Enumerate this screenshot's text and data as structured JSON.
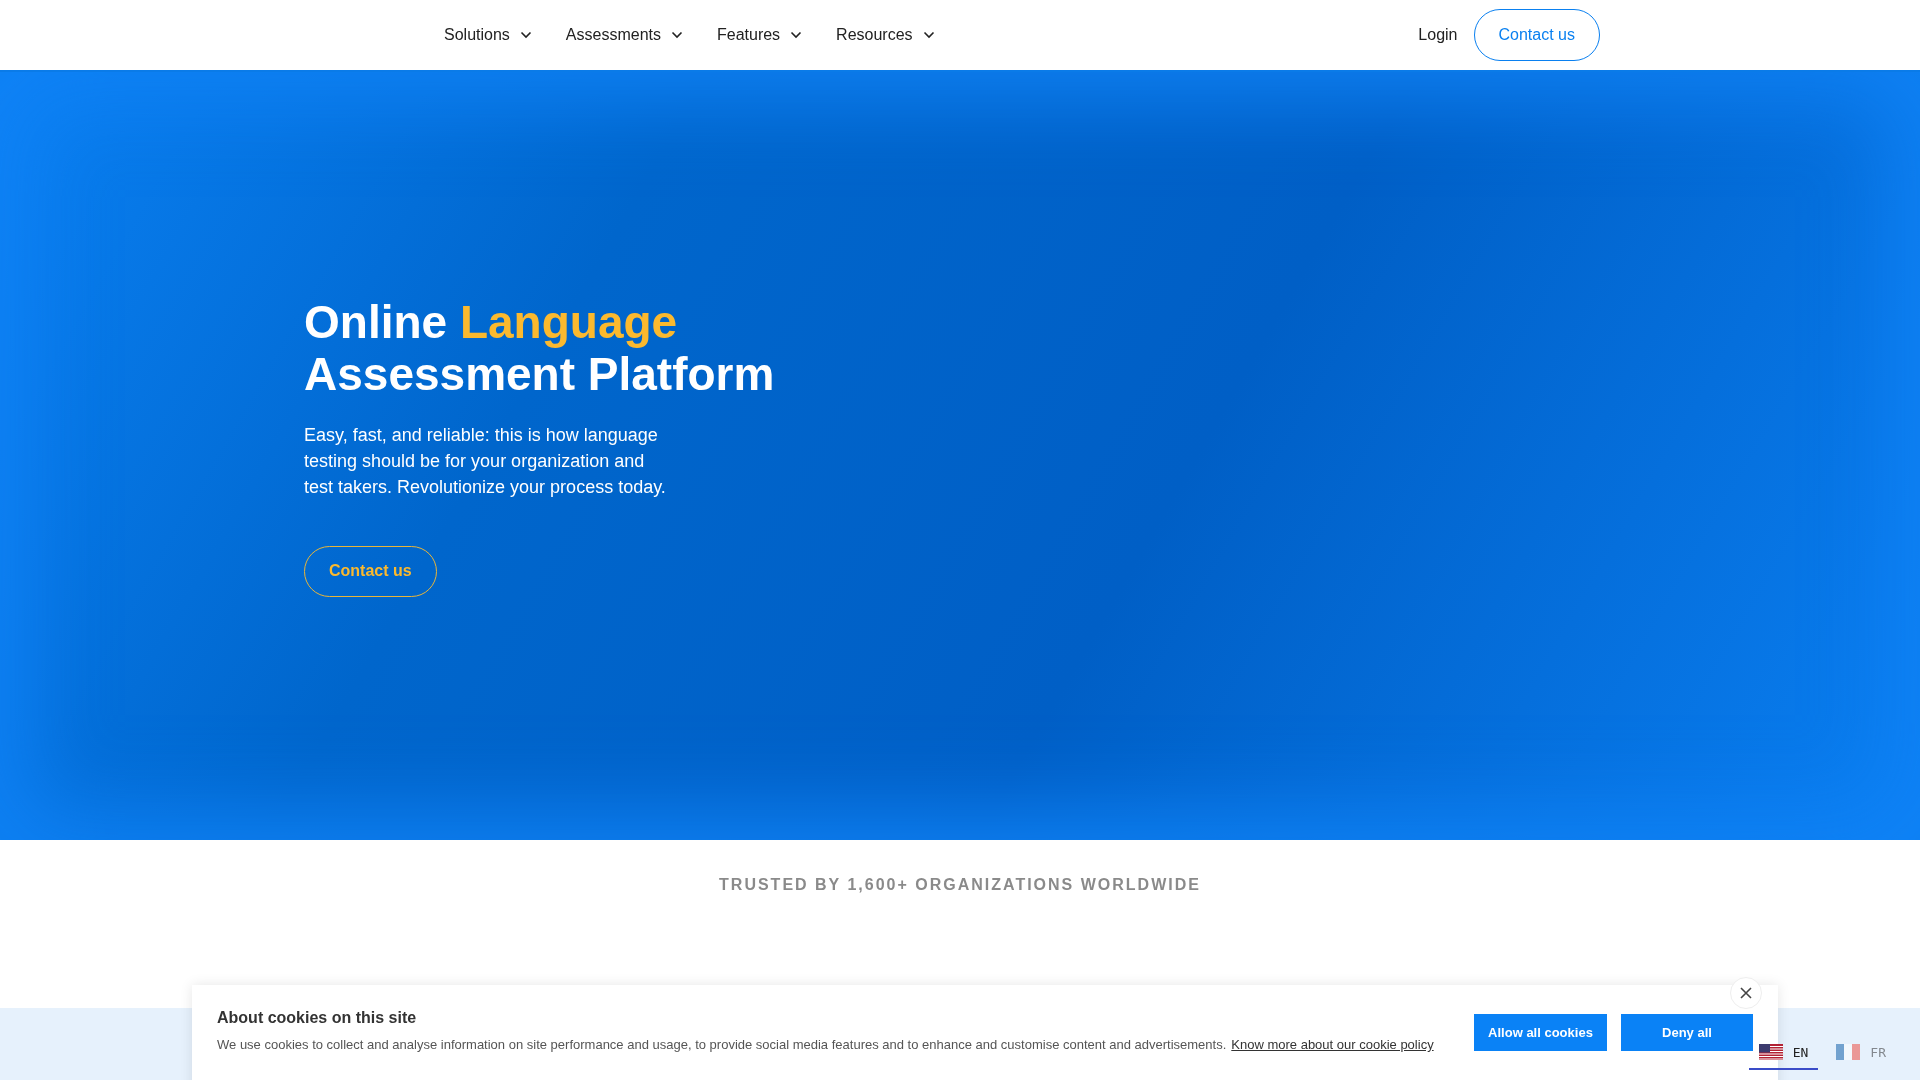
{
  "nav": {
    "items": [
      {
        "label": "Solutions"
      },
      {
        "label": "Assessments"
      },
      {
        "label": "Features"
      },
      {
        "label": "Resources"
      }
    ],
    "login": "Login",
    "contact": "Contact us"
  },
  "hero": {
    "title_lines": [
      {
        "parts": [
          {
            "text": "Online",
            "highlight": false
          },
          {
            "text": "Language",
            "highlight": true
          }
        ]
      },
      {
        "parts": [
          {
            "text": "Assessment Platform",
            "highlight": false
          }
        ]
      }
    ],
    "description": "Easy, fast, and reliable: this is how language testing should be for your organization and test takers. Revolutionize your process today.",
    "button": "Contact us"
  },
  "trusted": "TRUSTED BY 1,600+ ORGANIZATIONS WORLDWIDE",
  "cookie_banner": {
    "title": "About cookies on this site",
    "text": "We use cookies to collect and analyse information on site performance and usage, to provide social media features and to enhance and customise content and advertisements.",
    "link": "Know more about our cookie policy",
    "buttons": [
      "Allow all cookies",
      "Deny all"
    ]
  },
  "languages": [
    {
      "label": "EN",
      "kind": "us",
      "selected": true
    },
    {
      "label": "FR",
      "kind": "fr",
      "selected": false
    }
  ]
}
